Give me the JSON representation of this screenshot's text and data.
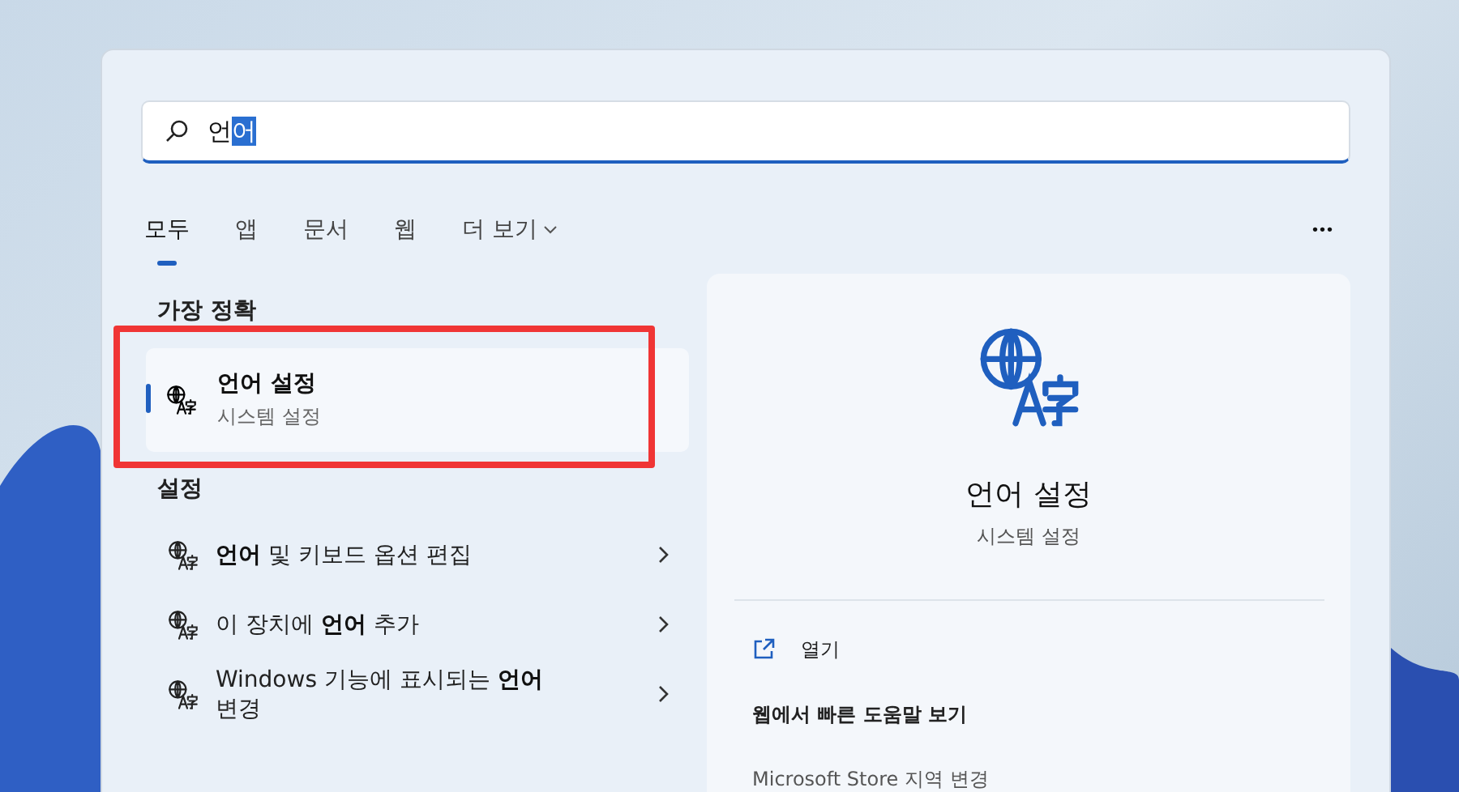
{
  "search": {
    "text_before": "언",
    "selected_text": "어"
  },
  "tabs": [
    {
      "label": "모두",
      "selected": true
    },
    {
      "label": "앱",
      "selected": false
    },
    {
      "label": "문서",
      "selected": false
    },
    {
      "label": "웹",
      "selected": false
    },
    {
      "label": "더 보기",
      "selected": false,
      "dropdown": true
    }
  ],
  "more_button": "•••",
  "best_match": {
    "heading": "가장 정확",
    "title": "언어 설정",
    "subtitle": "시스템 설정",
    "selected": true,
    "highlighted": true
  },
  "settings": {
    "heading": "설정",
    "items": [
      {
        "label": "**언어** 및 키보드 옵션 편집"
      },
      {
        "label": "이 장치에 **언어** 추가"
      },
      {
        "label": "Windows 기능에 표시되는 **언어** 변경"
      }
    ]
  },
  "preview": {
    "title": "언어 설정",
    "subtitle": "시스템 설정",
    "actions": [
      {
        "kind": "open",
        "label": "열기"
      },
      {
        "kind": "heading",
        "label": "웹에서 빠른 도움말 보기"
      },
      {
        "kind": "link",
        "label": "Microsoft Store 지역 변경"
      }
    ]
  }
}
